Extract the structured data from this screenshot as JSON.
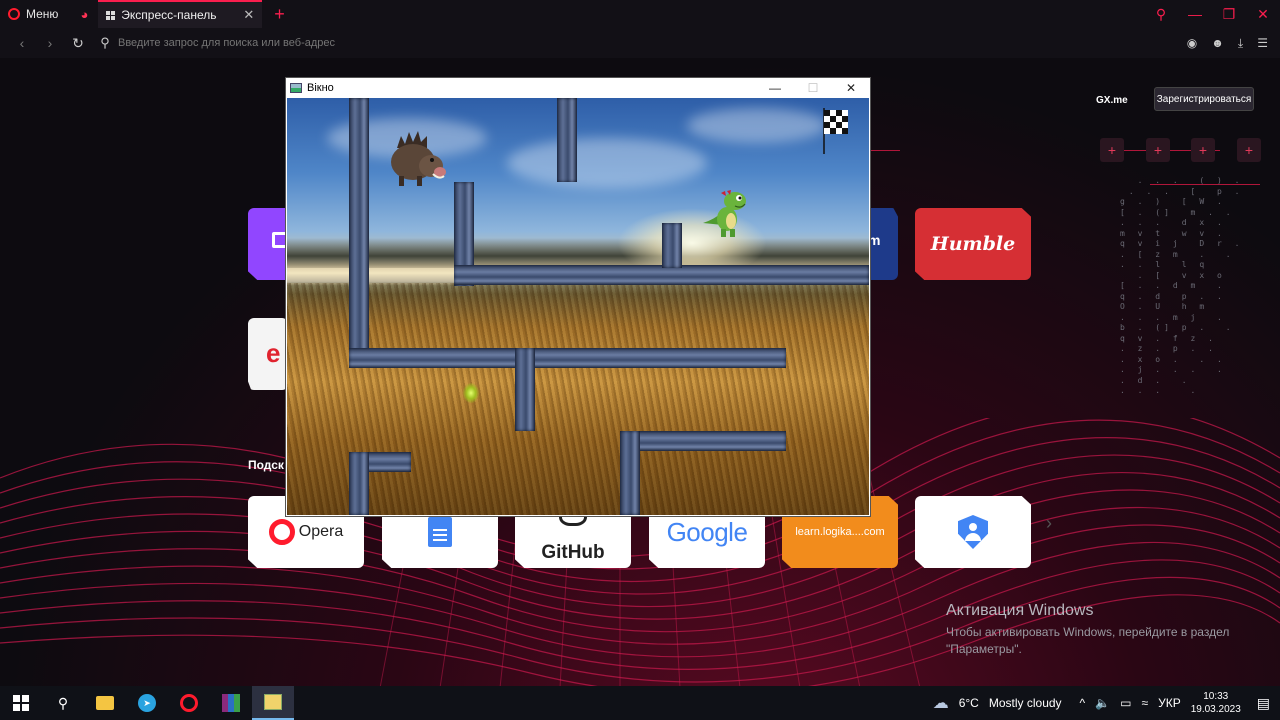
{
  "browser": {
    "menu_label": "Меню",
    "tab_title": "Экспресс-панель",
    "address_placeholder": "Введите запрос для поиска или веб-адрес"
  },
  "speed_dial": {
    "gx_me": "GX.me",
    "register_button": "Зарегистрироваться",
    "section_title": "Подск",
    "tiles": {
      "humble": "Humble",
      "partial_m": "m",
      "partial_e": "e",
      "opera": "Opera",
      "github": "GitHub",
      "google": "Google",
      "logika": "learn.logika....com"
    },
    "colors": {
      "accent": "#fa1e4e",
      "humble": "#d62f34",
      "logika": "#f28c1c",
      "twitch": "#9146ff"
    }
  },
  "activation": {
    "title": "Активация Windows",
    "line1": "Чтобы активировать Windows, перейдите в раздел",
    "line2": "\"Параметры\"."
  },
  "game_window": {
    "title": "Вікно",
    "sprites": [
      "boar-sprite",
      "dino-sprite",
      "finish-flag"
    ]
  },
  "taskbar": {
    "weather_temp": "6°C",
    "weather_desc": "Mostly cloudy",
    "language": "УКР",
    "time": "10:33",
    "date": "19.03.2023"
  }
}
